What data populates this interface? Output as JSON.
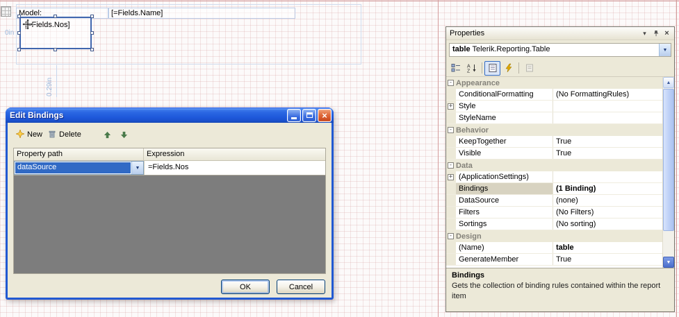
{
  "canvas": {
    "cells": {
      "model_label": "Model:",
      "name_expression": "[=Fields.Name]"
    },
    "selected_textbox": "[=Fields.Nos]",
    "ruler": {
      "origin": "0in",
      "height": "0.29in"
    }
  },
  "dialog": {
    "title": "Edit Bindings",
    "toolbar": {
      "new_label": "New",
      "delete_label": "Delete"
    },
    "grid": {
      "columns": [
        "Property path",
        "Expression"
      ],
      "rows": [
        {
          "property_path": "dataSource",
          "expression": "=Fields.Nos"
        }
      ]
    },
    "ok_label": "OK",
    "cancel_label": "Cancel"
  },
  "properties_panel": {
    "title": "Properties",
    "object_name": "table",
    "object_type": "Telerik.Reporting.Table",
    "rows": [
      {
        "kind": "category",
        "label": "Appearance"
      },
      {
        "kind": "property",
        "name": "ConditionalFormatting",
        "value": "(No FormattingRules)"
      },
      {
        "kind": "property",
        "name": "Style",
        "value": "",
        "expandable": true
      },
      {
        "kind": "property",
        "name": "StyleName",
        "value": ""
      },
      {
        "kind": "category",
        "label": "Behavior"
      },
      {
        "kind": "property",
        "name": "KeepTogether",
        "value": "True"
      },
      {
        "kind": "property",
        "name": "Visible",
        "value": "True"
      },
      {
        "kind": "category",
        "label": "Data"
      },
      {
        "kind": "property",
        "name": "(ApplicationSettings)",
        "value": "",
        "expandable": true
      },
      {
        "kind": "property",
        "name": "Bindings",
        "value": "(1 Binding)",
        "bold_value": true,
        "selected": true
      },
      {
        "kind": "property",
        "name": "DataSource",
        "value": "(none)"
      },
      {
        "kind": "property",
        "name": "Filters",
        "value": "(No Filters)"
      },
      {
        "kind": "property",
        "name": "Sortings",
        "value": "(No sorting)"
      },
      {
        "kind": "category",
        "label": "Design"
      },
      {
        "kind": "property",
        "name": "(Name)",
        "value": "table",
        "bold_value": true
      },
      {
        "kind": "property",
        "name": "GenerateMember",
        "value": "True"
      }
    ],
    "description": {
      "title": "Bindings",
      "text": "Gets the collection of binding rules contained within the report item"
    }
  },
  "icons": {
    "close": "×",
    "dropdown": "▼",
    "window_menu": "▾",
    "up": "▲",
    "down": "▼"
  },
  "colors": {
    "titlebar_blue": "#2a66e2",
    "selection_blue": "#316ac5",
    "panel_bg": "#ece9d8",
    "grid_line_pink": "#d6a4a4",
    "canvas_guide_blue": "#9cbade",
    "empty_grid_gray": "#7d7d7d"
  }
}
